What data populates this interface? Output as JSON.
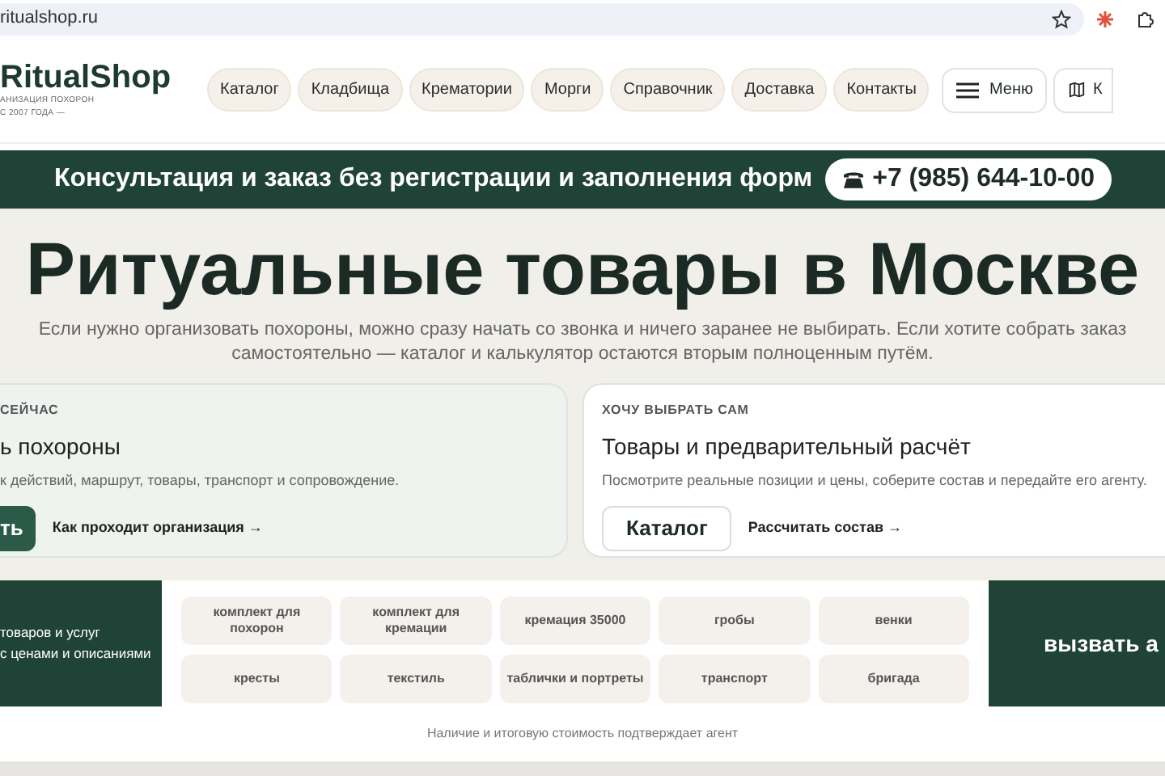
{
  "address_bar": {
    "url": "ritualshop.ru"
  },
  "header": {
    "logo": "RitualShop",
    "tagline_1": "АНИЗАЦИЯ ПОХОРОН",
    "tagline_2": "С 2007 ГОДА —",
    "nav": [
      "Каталог",
      "Кладбища",
      "Крематории",
      "Морги",
      "Справочник",
      "Доставка",
      "Контакты"
    ],
    "menu_button": "Меню",
    "map_button": "К"
  },
  "banner": {
    "text": "Консультация и заказ без регистрации и заполнения форм",
    "phone": "+7 (985) 644-10-00"
  },
  "hero": {
    "title": "Ритуальные товары в Москве",
    "subtitle": "Если нужно организовать похороны, можно сразу начать со звонка и ничего заранее не выбирать. Если хотите собрать заказ самостоятельно — каталог и калькулятор остаются вторым полноценным путём."
  },
  "cards": [
    {
      "eyebrow": "СЕЙЧАС",
      "title": "ь похороны",
      "text": "к действий, маршрут, товары, транспорт и сопровождение.",
      "button": "ть",
      "link": "Как проходит организация →",
      "kind": "primary"
    },
    {
      "eyebrow": "ХОЧУ ВЫБРАТЬ САМ",
      "title": "Товары и предварительный расчёт",
      "text": "Посмотрите реальные позиции и цены, соберите состав и передайте его агенту.",
      "button": "Каталог",
      "link": "Рассчитать состав →",
      "kind": "secondary"
    }
  ],
  "catalog": {
    "intro_1": "товаров и услуг",
    "intro_2": "с ценами и описаниями",
    "chips": [
      "комплект для похорон",
      "комплект для кремации",
      "кремация 35000",
      "гробы",
      "венки",
      "кресты",
      "текстиль",
      "таблички и портреты",
      "транспорт",
      "бригада"
    ],
    "cta": "вызвать а",
    "note": "Наличие и итоговую стоимость подтверждает агент"
  }
}
